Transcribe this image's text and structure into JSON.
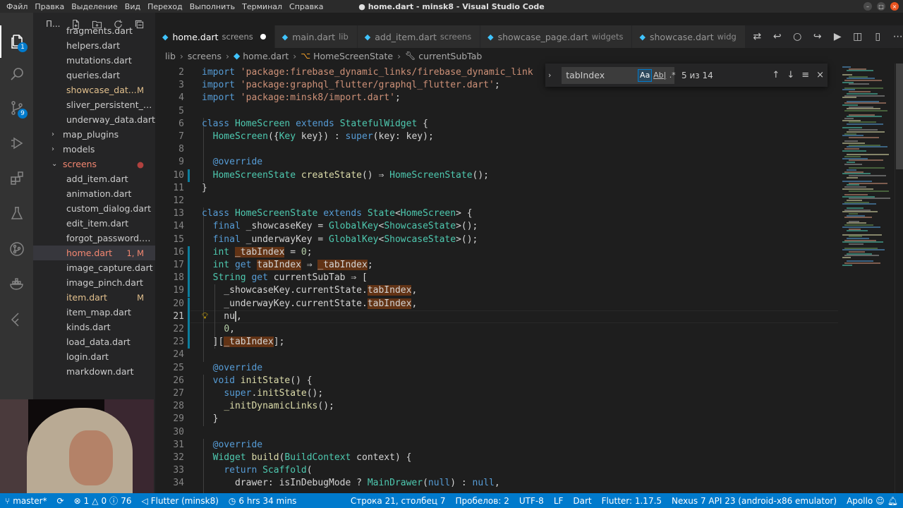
{
  "menu": [
    "Файл",
    "Правка",
    "Выделение",
    "Вид",
    "Переход",
    "Выполнить",
    "Терминал",
    "Справка"
  ],
  "window_title": "● home.dart - minsk8 - Visual Studio Code",
  "window_buttons": {
    "minimize": "–",
    "maximize": "□",
    "close": "×"
  },
  "activity": {
    "explorer_badge": "1",
    "search_badge": "",
    "scm_badge": "9"
  },
  "sidebar": {
    "title": "П...",
    "items": [
      {
        "type": "file",
        "label": "fragments.dart",
        "status": ""
      },
      {
        "type": "file",
        "label": "helpers.dart",
        "status": ""
      },
      {
        "type": "file",
        "label": "mutations.dart",
        "status": ""
      },
      {
        "type": "file",
        "label": "queries.dart",
        "status": ""
      },
      {
        "type": "file",
        "label": "showcase_dat...",
        "status": "M"
      },
      {
        "type": "file",
        "label": "sliver_persistent_h...",
        "status": ""
      },
      {
        "type": "file",
        "label": "underway_data.dart",
        "status": ""
      },
      {
        "type": "folder",
        "label": "map_plugins",
        "chevron": ">",
        "status": ""
      },
      {
        "type": "folder",
        "label": "models",
        "chevron": ">",
        "status": ""
      },
      {
        "type": "folder-open",
        "label": "screens",
        "chevron": "v",
        "status": "●"
      },
      {
        "type": "file",
        "label": "add_item.dart",
        "status": ""
      },
      {
        "type": "file",
        "label": "animation.dart",
        "status": ""
      },
      {
        "type": "file",
        "label": "custom_dialog.dart",
        "status": ""
      },
      {
        "type": "file",
        "label": "edit_item.dart",
        "status": ""
      },
      {
        "type": "file",
        "label": "forgot_password.dart",
        "status": ""
      },
      {
        "type": "file",
        "label": "home.dart",
        "status": "1, M",
        "selected": true
      },
      {
        "type": "file",
        "label": "image_capture.dart",
        "status": ""
      },
      {
        "type": "file",
        "label": "image_pinch.dart",
        "status": ""
      },
      {
        "type": "file",
        "label": "item.dart",
        "status": "M"
      },
      {
        "type": "file",
        "label": "item_map.dart",
        "status": ""
      },
      {
        "type": "file",
        "label": "kinds.dart",
        "status": ""
      },
      {
        "type": "file",
        "label": "load_data.dart",
        "status": ""
      },
      {
        "type": "file",
        "label": "login.dart",
        "status": ""
      },
      {
        "type": "file",
        "label": "markdown.dart",
        "status": ""
      }
    ]
  },
  "tabs": [
    {
      "label": "home.dart",
      "desc": "screens",
      "active": true,
      "dirty": true
    },
    {
      "label": "main.dart",
      "desc": "lib",
      "active": false
    },
    {
      "label": "add_item.dart",
      "desc": "screens",
      "active": false
    },
    {
      "label": "showcase_page.dart",
      "desc": "widgets",
      "active": false
    },
    {
      "label": "showcase.dart",
      "desc": "widg",
      "active": false
    }
  ],
  "breadcrumbs": [
    "lib",
    "screens",
    "home.dart",
    "HomeScreenState",
    "currentSubTab"
  ],
  "find": {
    "query": "tabIndex",
    "match_case": "Aa",
    "whole_word": "Ab|",
    "regex": ".*",
    "count": "5 из 14"
  },
  "code_lines": [
    {
      "n": "2",
      "html": "<span class=\"kw\">import</span> <span class=\"st2\">'package:firebase_dynamic_links/firebase_dynamic_link</span>"
    },
    {
      "n": "3",
      "html": "<span class=\"kw\">import</span> <span class=\"st2\">'package:graphql_flutter/graphql_flutter.dart'</span>;"
    },
    {
      "n": "4",
      "html": "<span class=\"kw\">import</span> <span class=\"st2\">'package:minsk8/import.dart'</span>;"
    },
    {
      "n": "5",
      "html": ""
    },
    {
      "n": "6",
      "html": "<span class=\"kw\">class</span> <span class=\"tp\">HomeScreen</span> <span class=\"kw\">extends</span> <span class=\"tp\">StatefulWidget</span> {"
    },
    {
      "n": "7",
      "html": "  <span class=\"tp\">HomeScreen</span>({<span class=\"tp\">Key</span> key}) : <span class=\"kw\">super</span>(key: key);"
    },
    {
      "n": "8",
      "html": ""
    },
    {
      "n": "9",
      "html": "  <span class=\"an\">@override</span>"
    },
    {
      "n": "10",
      "html": "  <span class=\"tp\">HomeScreenState</span> <span class=\"fn\">createState</span>() ⇒ <span class=\"tp\">HomeScreenState</span>();"
    },
    {
      "n": "11",
      "html": "}"
    },
    {
      "n": "12",
      "html": ""
    },
    {
      "n": "13",
      "html": "<span class=\"kw\">class</span> <span class=\"tp\">HomeScreenState</span> <span class=\"kw\">extends</span> <span class=\"tp\">State</span>&lt;<span class=\"tp\">HomeScreen</span>&gt; {"
    },
    {
      "n": "14",
      "html": "  <span class=\"kw\">final</span> _showcaseKey = <span class=\"tp\">GlobalKey</span>&lt;<span class=\"tp\">ShowcaseState</span>&gt;();"
    },
    {
      "n": "15",
      "html": "  <span class=\"kw\">final</span> _underwayKey = <span class=\"tp\">GlobalKey</span>&lt;<span class=\"tp\">ShowcaseState</span>&gt;();"
    },
    {
      "n": "16",
      "html": "  <span class=\"tp\">int</span> <span class=\"hl\">_tabIndex</span> = <span class=\"nm\">0</span>;"
    },
    {
      "n": "17",
      "html": "  <span class=\"tp\">int</span> <span class=\"kw\">get</span> <span class=\"hl\">tabIndex</span> ⇒ <span class=\"hl\">_tabIndex</span>;"
    },
    {
      "n": "18",
      "html": "  <span class=\"tp\">String</span> <span class=\"kw\">get</span> currentSubTab ⇒ ["
    },
    {
      "n": "19",
      "html": "    _showcaseKey.currentState.<span class=\"hl\">tabIndex</span>,"
    },
    {
      "n": "20",
      "html": "    _underwayKey.currentState.<span class=\"hl\">tabIndex</span>,"
    },
    {
      "n": "21",
      "html": "    nu<span class=\"cursor\"></span>,",
      "current": true
    },
    {
      "n": "22",
      "html": "    <span class=\"nm\">0</span>,"
    },
    {
      "n": "23",
      "html": "  ][<span class=\"hl\">_tabIndex</span>];"
    },
    {
      "n": "24",
      "html": ""
    },
    {
      "n": "25",
      "html": "  <span class=\"an\">@override</span>"
    },
    {
      "n": "26",
      "html": "  <span class=\"kw\">void</span> <span class=\"fn\">initState</span>() {"
    },
    {
      "n": "27",
      "html": "    <span class=\"kw\">super</span>.<span class=\"fn\">initState</span>();"
    },
    {
      "n": "28",
      "html": "    <span class=\"fn\">_initDynamicLinks</span>();"
    },
    {
      "n": "29",
      "html": "  }"
    },
    {
      "n": "30",
      "html": ""
    },
    {
      "n": "31",
      "html": "  <span class=\"an\">@override</span>"
    },
    {
      "n": "32",
      "html": "  <span class=\"tp\">Widget</span> <span class=\"fn\">build</span>(<span class=\"tp\">BuildContext</span> context) {"
    },
    {
      "n": "33",
      "html": "    <span class=\"kw\">return</span> <span class=\"tp\">Scaffold</span>("
    },
    {
      "n": "34",
      "html": "      drawer: isInDebugMode ? <span class=\"tp\">MainDrawer</span>(<span class=\"kw\">null</span>) : <span class=\"kw\">null</span>,"
    }
  ],
  "statusbar": {
    "branch": "master*",
    "errors": "1",
    "warnings": "0",
    "info": "76",
    "flutter": "Flutter (minsk8)",
    "time": "6 hrs 34 mins",
    "position": "Строка 21, столбец 7",
    "spaces": "Пробелов: 2",
    "encoding": "UTF-8",
    "eol": "LF",
    "language": "Dart",
    "flutter_version": "Flutter: 1.17.5",
    "device": "Nexus 7 API 23 (android-x86 emulator)",
    "apollo": "Apollo"
  },
  "colors": {
    "accent": "#007acc",
    "selection": "#37373d",
    "find_match": "#623315"
  }
}
